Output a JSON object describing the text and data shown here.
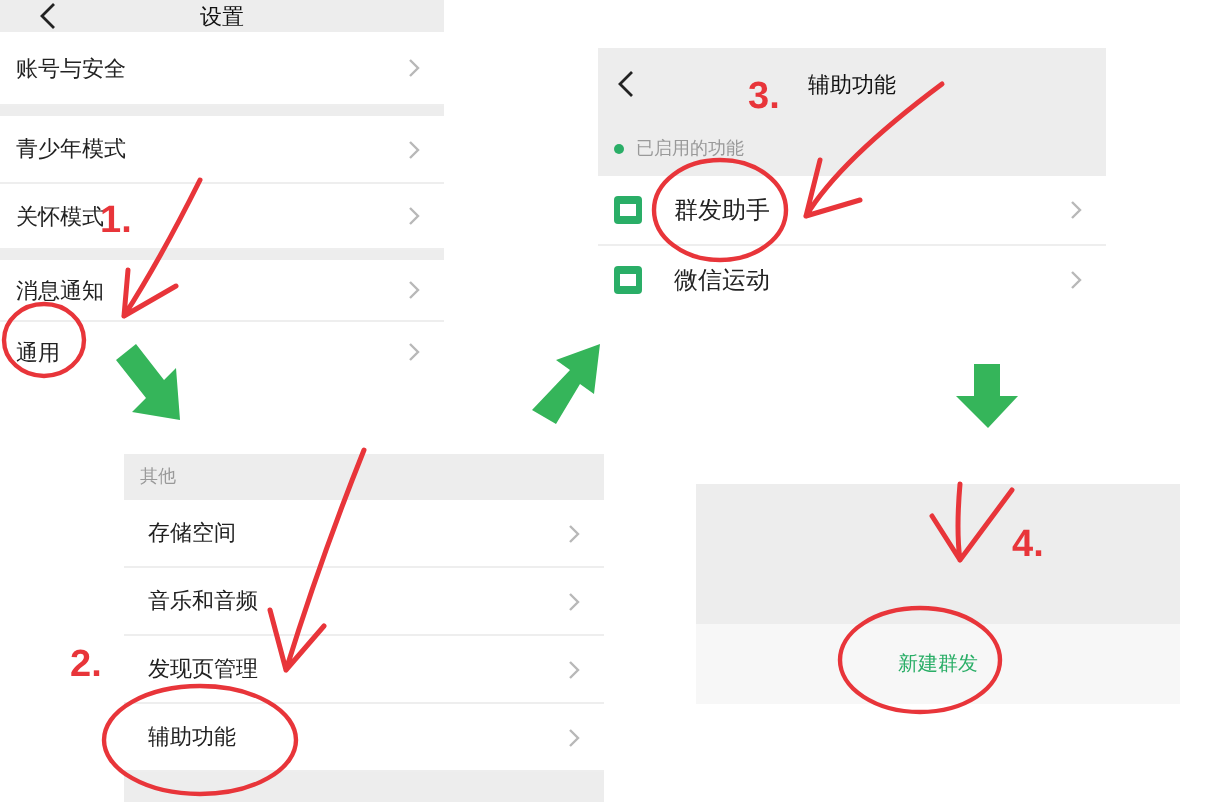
{
  "settings_screen": {
    "title": "设置",
    "groups": [
      [
        "账号与安全"
      ],
      [
        "青少年模式",
        "关怀模式"
      ],
      [
        "消息通知",
        "通用"
      ]
    ]
  },
  "general_screen": {
    "section": "其他",
    "rows": [
      "存储空间",
      "音乐和音频",
      "发现页管理",
      "辅助功能"
    ]
  },
  "accessibility_screen": {
    "title": "辅助功能",
    "section": "已启用的功能",
    "rows": [
      "群发助手",
      "微信运动"
    ]
  },
  "broadcast_screen": {
    "button": "新建群发"
  },
  "steps": [
    "1.",
    "2.",
    "3.",
    "4."
  ]
}
